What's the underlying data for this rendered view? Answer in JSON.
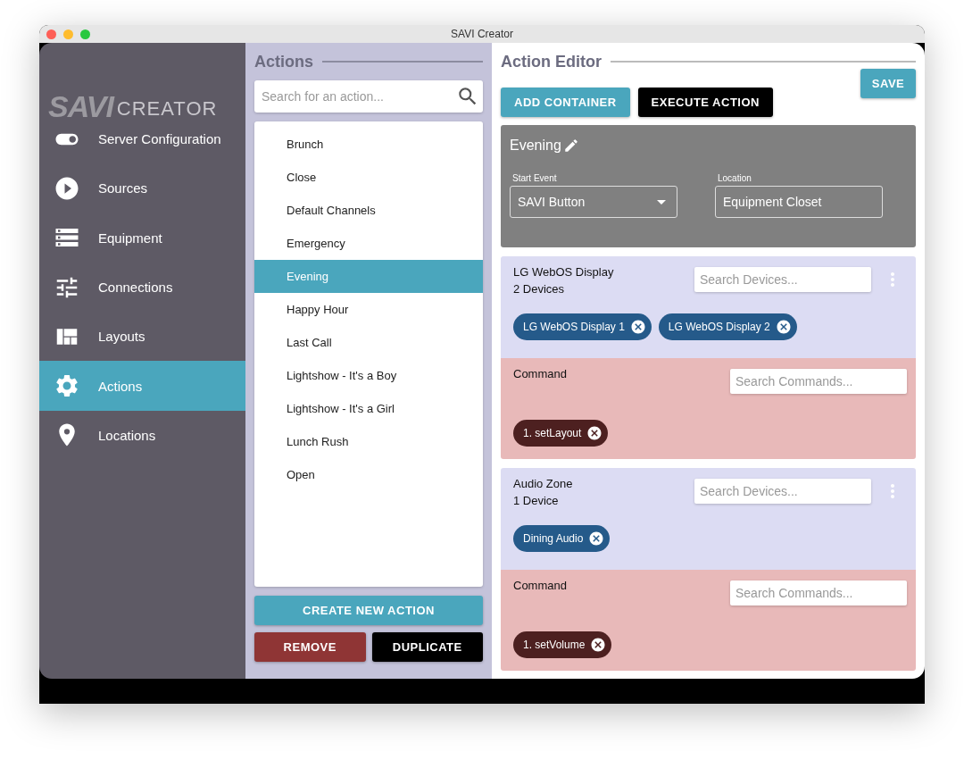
{
  "window": {
    "title": "SAVI Creator"
  },
  "sidebar": {
    "logo": {
      "mark": "SAVI",
      "word": "CREATOR"
    },
    "items": [
      {
        "label": "Server Configuration",
        "kind": "toggle",
        "selected": false
      },
      {
        "label": "Sources",
        "kind": "play",
        "selected": false
      },
      {
        "label": "Equipment",
        "kind": "storage",
        "selected": false
      },
      {
        "label": "Connections",
        "kind": "tune",
        "selected": false
      },
      {
        "label": "Layouts",
        "kind": "quilt",
        "selected": false
      },
      {
        "label": "Actions",
        "kind": "gear",
        "selected": true
      },
      {
        "label": "Locations",
        "kind": "pin",
        "selected": false
      }
    ]
  },
  "actions": {
    "title": "Actions",
    "search": {
      "placeholder": "Search for an action..."
    },
    "items": [
      {
        "label": "Brunch",
        "selected": false
      },
      {
        "label": "Close",
        "selected": false
      },
      {
        "label": "Default Channels",
        "selected": false
      },
      {
        "label": "Emergency",
        "selected": false
      },
      {
        "label": "Evening",
        "selected": true
      },
      {
        "label": "Happy Hour",
        "selected": false
      },
      {
        "label": "Last Call",
        "selected": false
      },
      {
        "label": "Lightshow - It's a Boy",
        "selected": false
      },
      {
        "label": "Lightshow - It's a Girl",
        "selected": false
      },
      {
        "label": "Lunch Rush",
        "selected": false
      },
      {
        "label": "Open",
        "selected": false
      }
    ],
    "create_button": "CREATE NEW ACTION",
    "remove_button": "REMOVE",
    "duplicate_button": "DUPLICATE"
  },
  "editor": {
    "title": "Action Editor",
    "save_button": "SAVE",
    "add_container_button": "ADD CONTAINER",
    "execute_button": "EXECUTE ACTION",
    "action": {
      "name": "Evening",
      "start_event": {
        "label": "Start Event",
        "value": "SAVI Button"
      },
      "location": {
        "label": "Location",
        "value": "Equipment Closet"
      }
    },
    "containers": [
      {
        "name": "LG WebOS Display",
        "count": "2 Devices",
        "search": {
          "placeholder": "Search Devices..."
        },
        "devices": [
          "LG WebOS Display 1",
          "LG WebOS Display 2"
        ],
        "command": {
          "label": "Command",
          "search": {
            "placeholder": "Search Commands..."
          },
          "commands": [
            "1. setLayout"
          ]
        }
      },
      {
        "name": "Audio Zone",
        "count": "1 Device",
        "search": {
          "placeholder": "Search Devices..."
        },
        "devices": [
          "Dining Audio"
        ],
        "command": {
          "label": "Command",
          "search": {
            "placeholder": "Search Commands..."
          },
          "commands": [
            "1. setVolume"
          ]
        }
      }
    ]
  }
}
